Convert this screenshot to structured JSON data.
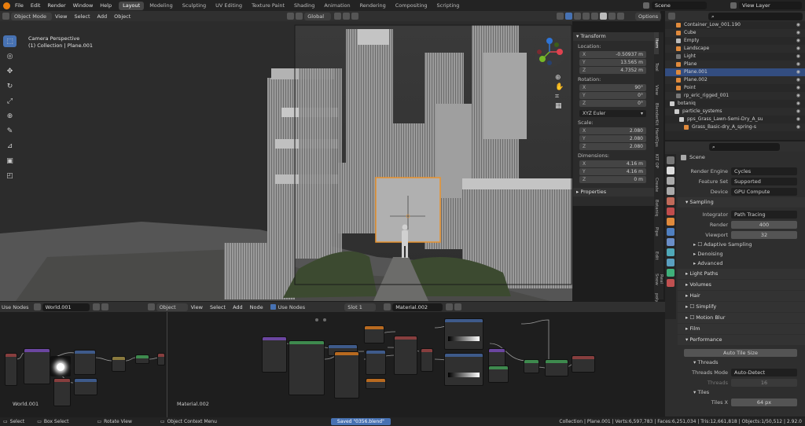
{
  "topbar": {
    "menus": [
      "File",
      "Edit",
      "Render",
      "Window",
      "Help"
    ],
    "workspaces": [
      "Layout",
      "Modeling",
      "Sculpting",
      "UV Editing",
      "Texture Paint",
      "Shading",
      "Animation",
      "Rendering",
      "Compositing",
      "Scripting"
    ],
    "active_workspace": "Layout",
    "scene": "Scene",
    "view_layer": "View Layer"
  },
  "viewport_header": {
    "mode": "Object Mode",
    "menus": [
      "View",
      "Select",
      "Add",
      "Object"
    ],
    "orientation": "Global",
    "options": "Options"
  },
  "viewport": {
    "perspective": "Camera Perspective",
    "collection": "(1) Collection | Plane.001"
  },
  "npanel": {
    "transform_header": "Transform",
    "location_label": "Location:",
    "location": [
      {
        "k": "X",
        "v": "-0.50937 m"
      },
      {
        "k": "Y",
        "v": "13.565 m"
      },
      {
        "k": "Z",
        "v": "4.7352 m"
      }
    ],
    "rotation_label": "Rotation:",
    "rotation": [
      {
        "k": "X",
        "v": "90°"
      },
      {
        "k": "Y",
        "v": "0°"
      },
      {
        "k": "Z",
        "v": "0°"
      }
    ],
    "rotation_mode": "XYZ Euler",
    "scale_label": "Scale:",
    "scale": [
      {
        "k": "X",
        "v": "2.080"
      },
      {
        "k": "Y",
        "v": "2.080"
      },
      {
        "k": "Z",
        "v": "2.080"
      }
    ],
    "dimensions_label": "Dimensions:",
    "dimensions": [
      {
        "k": "X",
        "v": "4.16 m"
      },
      {
        "k": "Y",
        "v": "4.16 m"
      },
      {
        "k": "Z",
        "v": "0 m"
      }
    ],
    "properties_header": "Properties"
  },
  "ntabs": [
    "Item",
    "Tool",
    "View",
    "BlenderKit",
    "HardOps",
    "KIT OP",
    "Create",
    "Botaniq",
    "Pipe",
    "Edit",
    "Real Snow",
    "polyquilt"
  ],
  "outliner": {
    "rows": [
      {
        "name": "Container_Low_001.190",
        "color": "#e08a3c"
      },
      {
        "name": "Cube",
        "color": "#e08a3c"
      },
      {
        "name": "Empty",
        "color": "#bbbbbb"
      },
      {
        "name": "Landscape",
        "color": "#e08a3c"
      },
      {
        "name": "Light",
        "color": "#777777"
      },
      {
        "name": "Plane",
        "color": "#e08a3c"
      },
      {
        "name": "Plane.001",
        "color": "#e08a3c"
      },
      {
        "name": "Plane.002",
        "color": "#e08a3c"
      },
      {
        "name": "Point",
        "color": "#e08a3c"
      },
      {
        "name": "rp_eric_rigged_001",
        "color": "#777777"
      },
      {
        "name": "botaniq",
        "color": "#cccccc"
      },
      {
        "name": "particle_systems",
        "color": "#cccccc"
      },
      {
        "name": "pps_Grass_Lawn-Semi-Dry_A_su",
        "color": "#cccccc"
      },
      {
        "name": "Grass_Basic-dry_A_spring-s",
        "color": "#e08a3c"
      }
    ],
    "selected_index": 6
  },
  "properties": {
    "scene_label": "Scene",
    "render_engine_label": "Render Engine",
    "render_engine": "Cycles",
    "feature_set_label": "Feature Set",
    "feature_set": "Supported",
    "device_label": "Device",
    "device": "GPU Compute",
    "sampling": "Sampling",
    "integrator_label": "Integrator",
    "integrator": "Path Tracing",
    "render_label": "Render",
    "render_samples": "400",
    "viewport_label": "Viewport",
    "viewport_samples": "32",
    "adaptive_sampling": "Adaptive Sampling",
    "denoising": "Denoising",
    "advanced": "Advanced",
    "light_paths": "Light Paths",
    "volumes": "Volumes",
    "hair": "Hair",
    "simplify": "Simplify",
    "motion_blur": "Motion Blur",
    "film": "Film",
    "performance": "Performance",
    "auto_tile_size": "Auto Tile Size",
    "threads": "Threads",
    "threads_mode_label": "Threads Mode",
    "threads_mode": "Auto-Detect",
    "threads_label": "Threads",
    "threads_value": "16",
    "tiles": "Tiles",
    "tiles_x_label": "Tiles X",
    "tiles_x": "64 px"
  },
  "node_header": {
    "use_nodes_left": "Use Nodes",
    "world": "World.001",
    "object": "Object",
    "menus": [
      "View",
      "Select",
      "Add",
      "Node"
    ],
    "use_nodes": "Use Nodes",
    "slot": "Slot 1",
    "material": "Material.002"
  },
  "node_labels": {
    "world": "World.001",
    "material": "Material.002"
  },
  "status": {
    "select": "Select",
    "box_select": "Box Select",
    "rotate_view": "Rotate View",
    "context_menu": "Object Context Menu",
    "saved": "Saved \"0356.blend\"",
    "stats": "Collection | Plane.001 | Verts:6,597,783 | Faces:6,251,034 | Tris:12,661,818 | Objects:1/50,512 | 2.92.0"
  },
  "colors": {
    "accent": "#4772b3",
    "selection_outline": "#e9932e",
    "header": "#303030",
    "panel": "#2e2e2e"
  }
}
